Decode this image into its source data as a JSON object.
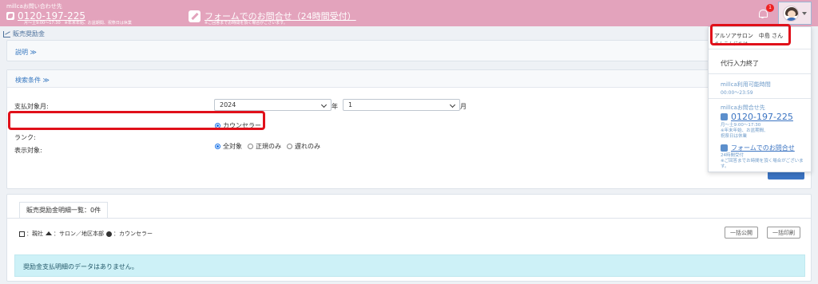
{
  "header": {
    "contact_title": "millcaお問い合わせ先",
    "phone": "0120-197-225",
    "hours_note": "月～土9:00～17:30　※年末年始、お盆期間、祝祭日は休業",
    "form_label": "フォームでのお問合せ（24時間受付）",
    "form_note": "※ご回答までお時間を頂く場合がございます。",
    "notification_count": "1",
    "colors": {
      "bar": "#e3a3bc",
      "accent": "#3b74c2",
      "highlight": "#e0101a"
    }
  },
  "breadcrumb": {
    "label": "販売奨励金"
  },
  "explain": {
    "label": "説明 ≫"
  },
  "search": {
    "toggle_label": "検索条件 ≫",
    "payment_month_label": "支払対象月:",
    "year_value": "2024",
    "year_unit": "年",
    "month_value": "1",
    "month_unit": "月",
    "rank_label": "ランク:",
    "rank_option": "カウンセラー",
    "display_label": "表示対象:",
    "display_options": [
      "全対象",
      "正規のみ",
      "遅れのみ"
    ]
  },
  "list": {
    "tab_label": "販売奨励金明細一覧：0件",
    "legend_head": "：親社",
    "legend_salon": "：サロン／地区本部",
    "legend_counselor": "：カウンセラー",
    "btn_bulk_open": "一括公開",
    "btn_bulk_print": "一括印刷",
    "empty_message": "奨励金支払明細のデータはありません。"
  },
  "user_menu": {
    "name": "アルソアサロン　中島 さん",
    "greeting": "さんこんにちは",
    "end_proxy": "代行入力終了",
    "hours_title": "millca利用可能時間",
    "hours": "00:00～23:59",
    "contact_title": "millcaお問合せ先",
    "phone": "0120-197-225",
    "phone_note_1": "月～土9:00～17:30",
    "phone_note_2": "※年末年始、お盆期間、",
    "phone_note_3": "祝祭日は休業",
    "form_label": "フォームでのお問合せ",
    "form_note_1": "24時間受付",
    "form_note_2": "※ご回答までお時間を頂く場合がございます。"
  }
}
